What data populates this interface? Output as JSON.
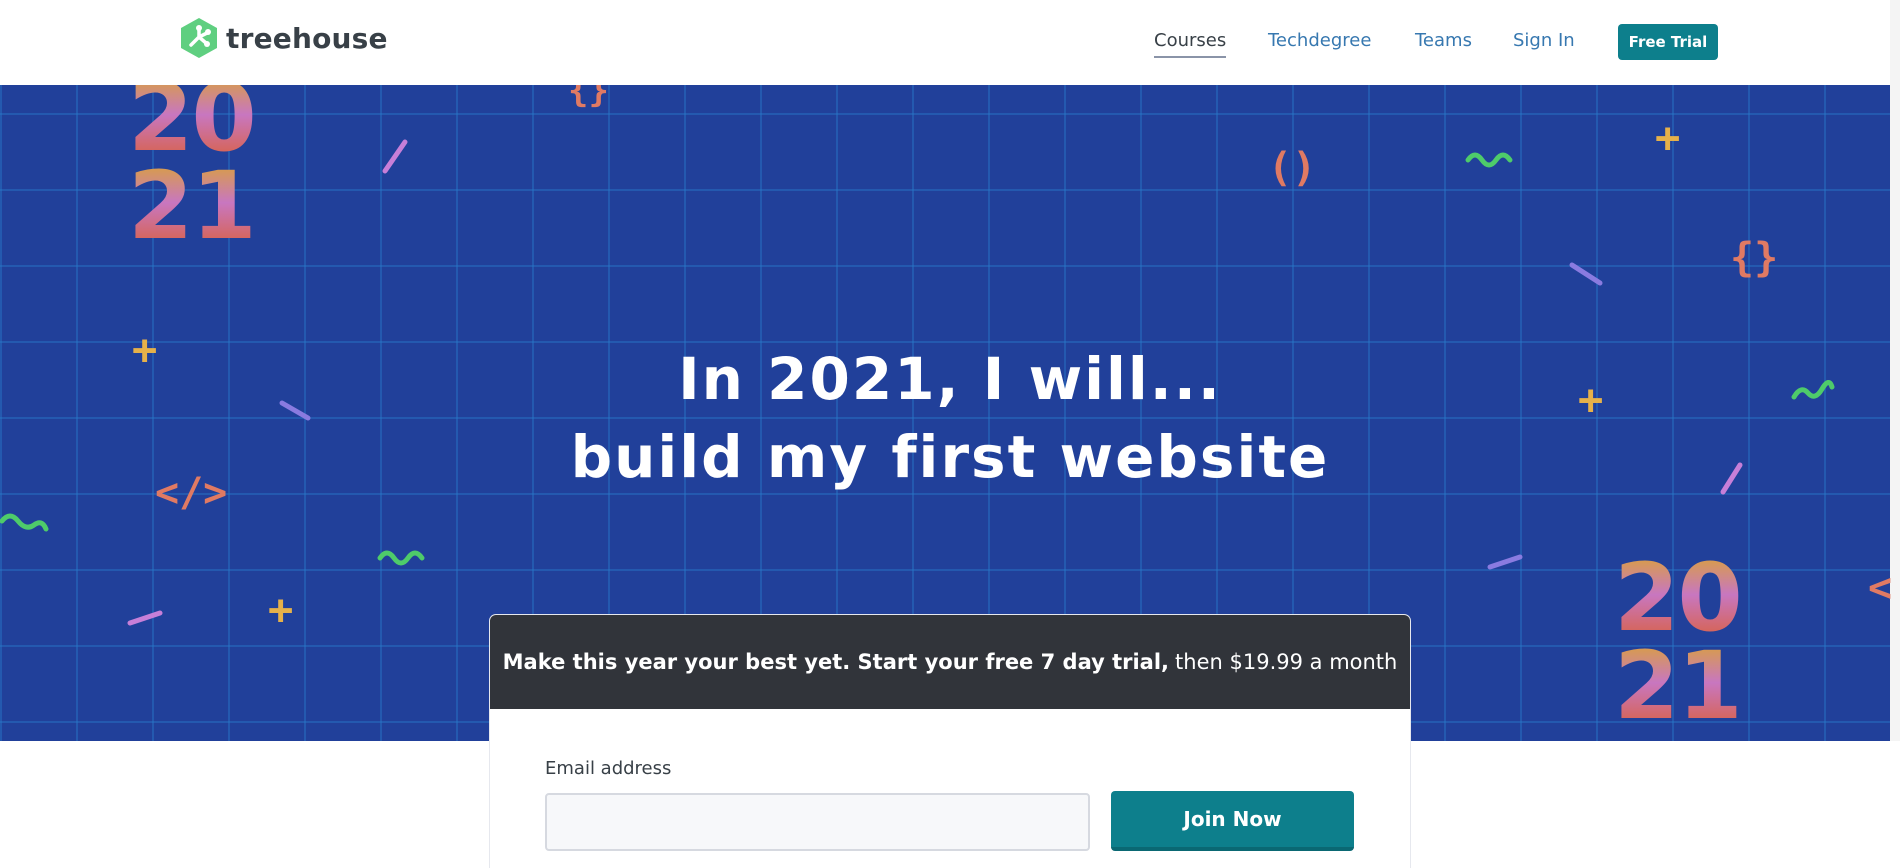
{
  "header": {
    "logo_text": "treehouse",
    "logo_icon": "treehouse-leaf-icon",
    "nav": [
      {
        "label": "Courses",
        "active": true
      },
      {
        "label": "Techdegree",
        "active": false
      },
      {
        "label": "Teams",
        "active": false
      },
      {
        "label": "Sign In",
        "active": false
      }
    ],
    "cta_label": "Free Trial"
  },
  "hero": {
    "headline_line1": "In 2021, I will...",
    "headline_line2": "build my first website",
    "year_top": "20",
    "year_bottom": "21",
    "glyphs": {
      "braces": "{}",
      "parens": "()",
      "tag": "</>",
      "plus": "+",
      "less_than": "<"
    }
  },
  "signup": {
    "banner_bold": "Make this year your best yet. Start your free 7 day trial,",
    "banner_rest": "then $19.99 a month",
    "email_label": "Email address",
    "email_value": "",
    "email_placeholder": "",
    "join_label": "Join Now"
  },
  "colors": {
    "hero_bg": "#21409a",
    "accent_teal": "#0d7f8c",
    "nav_link": "#3778b0",
    "banner_bg": "#31343a"
  }
}
